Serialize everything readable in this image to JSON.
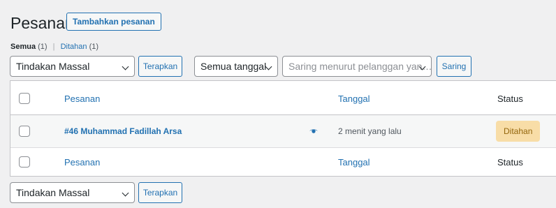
{
  "header": {
    "title": "Pesanan",
    "add_button": "Tambahkan pesanan"
  },
  "filters_nav": {
    "all_label": "Semua",
    "all_count": "(1)",
    "separator": "|",
    "hold_label": "Ditahan",
    "hold_count": "(1)"
  },
  "top_actions": {
    "bulk_select": "Tindakan Massal",
    "apply_button": "Terapkan",
    "date_select": "Semua tanggal",
    "customer_select_placeholder": "Saring menurut pelanggan yan…",
    "filter_button": "Saring"
  },
  "table": {
    "columns": [
      "Pesanan",
      "Tanggal",
      "Status"
    ],
    "rows": [
      {
        "order": "#46 Muhammad Fadillah Arsa",
        "date": "2 menit yang lalu",
        "status": "Ditahan"
      }
    ],
    "footer_columns": [
      "Pesanan",
      "Tanggal",
      "Status"
    ]
  },
  "bottom_actions": {
    "bulk_select": "Tindakan Massal",
    "apply_button": "Terapkan"
  },
  "colors": {
    "accent": "#2271b1",
    "status_hold_bg": "#f8dda7",
    "status_hold_text": "#94660c"
  },
  "icons": {
    "preview": "eye-icon"
  }
}
